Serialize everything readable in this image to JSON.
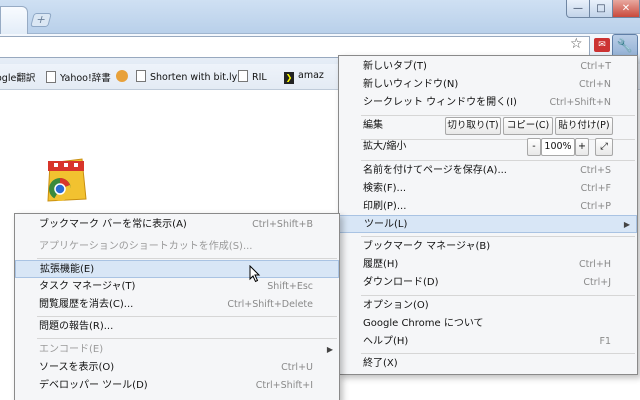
{
  "toolbar": {
    "new_tab": "+",
    "min": "—",
    "max": "□",
    "close": "✕",
    "wrench": "🔧",
    "badge": "✉"
  },
  "bookmarks": [
    {
      "label": "ogle翻訳",
      "icon": "none"
    },
    {
      "label": "Yahoo!辞書",
      "icon": "doc"
    },
    {
      "label": "",
      "icon": "orange"
    },
    {
      "label": "Shorten with bit.ly",
      "icon": "doc"
    },
    {
      "label": "RIL",
      "icon": "doc"
    },
    {
      "label": "amaz",
      "icon": "dark"
    }
  ],
  "main_menu": {
    "new_tab": {
      "label": "新しいタブ(T)",
      "sc": "Ctrl+T"
    },
    "new_window": {
      "label": "新しいウィンドウ(N)",
      "sc": "Ctrl+N"
    },
    "incognito": {
      "label": "シークレット ウィンドウを開く(I)",
      "sc": "Ctrl+Shift+N"
    },
    "edit": {
      "label": "編集",
      "cut": "切り取り(T)",
      "copy": "コピー(C)",
      "paste": "貼り付け(P)"
    },
    "zoom": {
      "label": "拡大/縮小",
      "minus": "-",
      "value": "100%",
      "plus": "+"
    },
    "save_as": {
      "label": "名前を付けてページを保存(A)...",
      "sc": "Ctrl+S"
    },
    "find": {
      "label": "検索(F)...",
      "sc": "Ctrl+F"
    },
    "print": {
      "label": "印刷(P)...",
      "sc": "Ctrl+P"
    },
    "tools": {
      "label": "ツール(L)"
    },
    "bookmark_manager": {
      "label": "ブックマーク マネージャ(B)"
    },
    "history": {
      "label": "履歴(H)",
      "sc": "Ctrl+H"
    },
    "downloads": {
      "label": "ダウンロード(D)",
      "sc": "Ctrl+J"
    },
    "options": {
      "label": "オプション(O)"
    },
    "about": {
      "label": "Google Chrome について"
    },
    "help": {
      "label": "ヘルプ(H)",
      "sc": "F1"
    },
    "exit": {
      "label": "終了(X)"
    }
  },
  "tools_menu": {
    "show_bookmarks_bar": {
      "label": "ブックマーク バーを常に表示(A)",
      "sc": "Ctrl+Shift+B"
    },
    "create_shortcuts": {
      "label": "アプリケーションのショートカットを作成(S)..."
    },
    "extensions": {
      "label": "拡張機能(E)"
    },
    "task_manager": {
      "label": "タスク マネージャ(T)",
      "sc": "Shift+Esc"
    },
    "clear_browsing": {
      "label": "閲覧履歴を消去(C)...",
      "sc": "Ctrl+Shift+Delete"
    },
    "report_issue": {
      "label": "問題の報告(R)..."
    },
    "encoding": {
      "label": "エンコード(E)"
    },
    "view_source": {
      "label": "ソースを表示(O)",
      "sc": "Ctrl+U"
    },
    "developer_tools": {
      "label": "デベロッパー ツール(D)",
      "sc": "Ctrl+Shift+I"
    }
  }
}
